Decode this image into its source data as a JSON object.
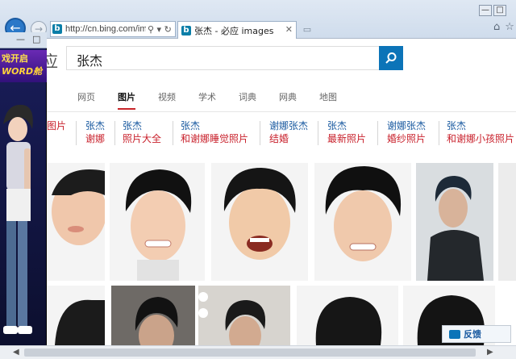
{
  "browser": {
    "url": "http://cn.bing.com/ima",
    "tab_title": "张杰 - 必应 images",
    "back_glyph": "←",
    "forward_glyph": "→",
    "address_icons": "⚲ ▾ ↻",
    "tab_close": "✕",
    "new_tab_glyph": "▭",
    "min_glyph": "—",
    "max_glyph": "□",
    "close_glyph": "✕",
    "right_icons": "⌂☆"
  },
  "bing": {
    "brand_fragment": "应",
    "query": "张杰",
    "tabs": [
      {
        "label": "网页",
        "active": false
      },
      {
        "label": "图片",
        "active": true
      },
      {
        "label": "视频",
        "active": false
      },
      {
        "label": "学术",
        "active": false
      },
      {
        "label": "词典",
        "active": false
      },
      {
        "label": "网典",
        "active": false
      },
      {
        "label": "地图",
        "active": false
      }
    ],
    "related": [
      {
        "line1": "",
        "line2": "图片"
      },
      {
        "line1": "张杰",
        "line2": "谢娜"
      },
      {
        "line1": "张杰",
        "line2": "照片大全"
      },
      {
        "line1": "张杰",
        "line2": "和谢娜睡觉照片"
      },
      {
        "line1": "谢娜张杰",
        "line2": "结婚"
      },
      {
        "line1": "张杰",
        "line2": "最新照片"
      },
      {
        "line1": "谢娜张杰",
        "line2": "婚纱照片"
      },
      {
        "line1": "张杰",
        "line2": "和谢娜小孩照片"
      }
    ],
    "feedback_label": "反馈"
  },
  "game": {
    "minimize": "—",
    "close": "□",
    "banner_line1": "戏开启",
    "banner_line2": "WORD舱"
  },
  "colors": {
    "accent": "#0c74b8",
    "related_blue": "#1a5aa0",
    "related_red": "#c81f2a",
    "active_tab_border": "#c8262a"
  }
}
